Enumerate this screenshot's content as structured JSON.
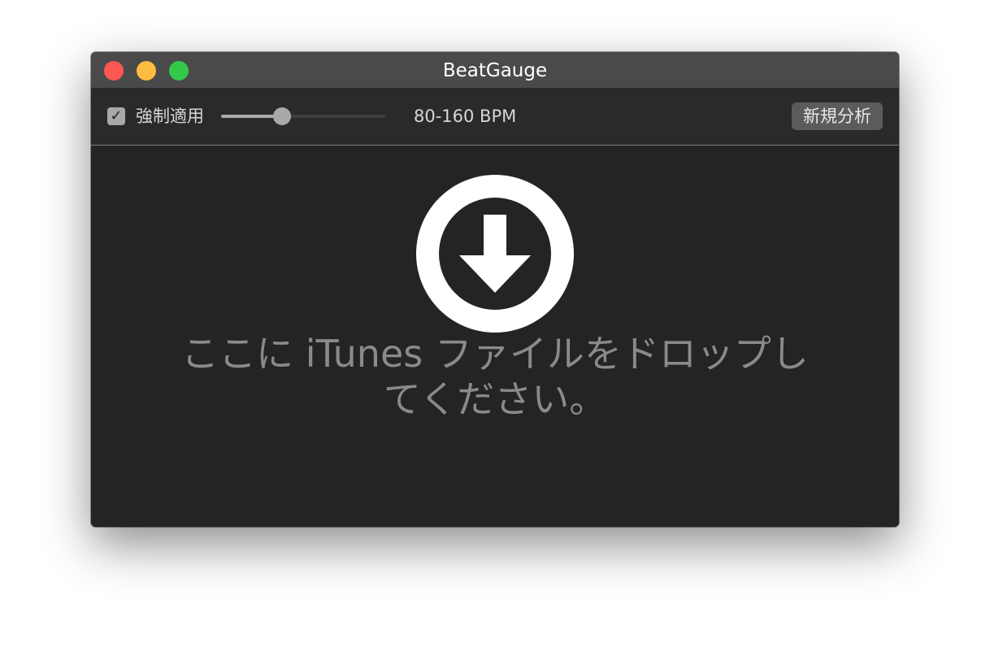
{
  "window": {
    "title": "BeatGauge"
  },
  "toolbar": {
    "force_apply_checked": true,
    "force_apply_label": "強制適用",
    "tempo_slider_level": 0.37,
    "bpm_range_label": "80-160 BPM",
    "new_analysis_label": "新規分析"
  },
  "drop_zone": {
    "icon": "download-arrow-circle-icon",
    "line1": "ここに iTunes ファイルをドロップし",
    "line2": "てください。"
  },
  "colors": {
    "close": "#fc5753",
    "minimize": "#fdbc40",
    "zoom": "#34c84a",
    "window_background": "#242424"
  }
}
